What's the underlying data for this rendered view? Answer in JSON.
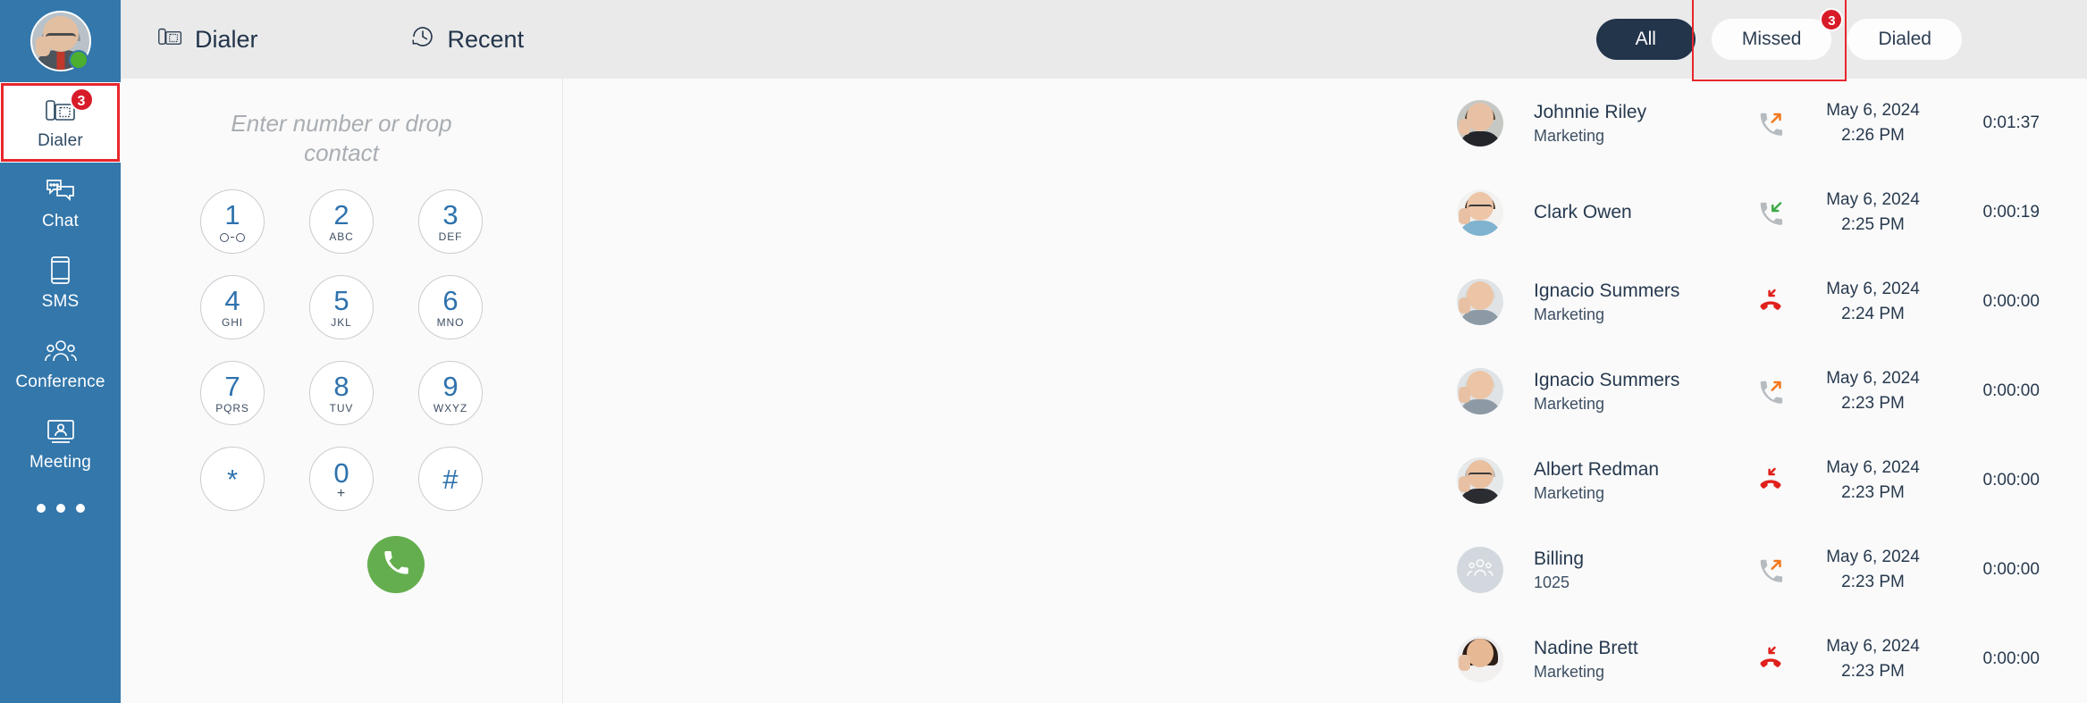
{
  "sidebar": {
    "avatar_name": "user-avatar",
    "presence": "online",
    "items": [
      {
        "id": "dialer",
        "label": "Dialer",
        "icon": "desk-phone-icon",
        "badge": "3",
        "active": true,
        "highlighted": true
      },
      {
        "id": "chat",
        "label": "Chat",
        "icon": "chat-bubbles-icon",
        "badge": "",
        "active": false,
        "highlighted": false
      },
      {
        "id": "sms",
        "label": "SMS",
        "icon": "mobile-phone-icon",
        "badge": "",
        "active": false,
        "highlighted": false
      },
      {
        "id": "conference",
        "label": "Conference",
        "icon": "people-group-icon",
        "badge": "",
        "active": false,
        "highlighted": false
      },
      {
        "id": "meeting",
        "label": "Meeting",
        "icon": "screen-person-icon",
        "badge": "",
        "active": false,
        "highlighted": false
      }
    ],
    "more_label": "more-options"
  },
  "topbar": {
    "dialer_title": "Dialer",
    "dialer_icon": "desk-phone-icon",
    "recent_title": "Recent",
    "recent_icon": "clock-history-icon",
    "filters": [
      {
        "id": "all",
        "label": "All",
        "active": true,
        "badge": "",
        "highlighted": false
      },
      {
        "id": "missed",
        "label": "Missed",
        "active": false,
        "badge": "3",
        "highlighted": true
      },
      {
        "id": "dialed",
        "label": "Dialed",
        "active": false,
        "badge": "",
        "highlighted": false
      }
    ]
  },
  "dialer": {
    "input_value": "",
    "input_placeholder": "Enter number or drop contact",
    "call_button_icon": "phone-handset-icon",
    "keys": [
      {
        "digit": "1",
        "sub": "",
        "icon": "voicemail-icon"
      },
      {
        "digit": "2",
        "sub": "ABC",
        "icon": ""
      },
      {
        "digit": "3",
        "sub": "DEF",
        "icon": ""
      },
      {
        "digit": "4",
        "sub": "GHI",
        "icon": ""
      },
      {
        "digit": "5",
        "sub": "JKL",
        "icon": ""
      },
      {
        "digit": "6",
        "sub": "MNO",
        "icon": ""
      },
      {
        "digit": "7",
        "sub": "PQRS",
        "icon": ""
      },
      {
        "digit": "8",
        "sub": "TUV",
        "icon": ""
      },
      {
        "digit": "9",
        "sub": "WXYZ",
        "icon": ""
      },
      {
        "digit": "*",
        "sub": "",
        "icon": ""
      },
      {
        "digit": "0",
        "sub": "+",
        "icon": ""
      },
      {
        "digit": "#",
        "sub": "",
        "icon": ""
      }
    ]
  },
  "call_list": {
    "rows": [
      {
        "name": "Johnnie Riley",
        "sub": "Marketing",
        "direction": "outgoing",
        "direction_icon": "outgoing-call-icon",
        "date": "May 6, 2024",
        "time": "2:26 PM",
        "duration": "0:01:37",
        "avatar": "photo-young-man-beard"
      },
      {
        "name": "Clark Owen",
        "sub": "",
        "direction": "incoming",
        "direction_icon": "incoming-call-icon",
        "date": "May 6, 2024",
        "time": "2:25 PM",
        "duration": "0:00:19",
        "avatar": "photo-man-glasses"
      },
      {
        "name": "Ignacio Summers",
        "sub": "Marketing",
        "direction": "missed",
        "direction_icon": "missed-call-icon",
        "date": "May 6, 2024",
        "time": "2:24 PM",
        "duration": "0:00:00",
        "avatar": "photo-older-man"
      },
      {
        "name": "Ignacio Summers",
        "sub": "Marketing",
        "direction": "outgoing",
        "direction_icon": "outgoing-call-icon",
        "date": "May 6, 2024",
        "time": "2:23 PM",
        "duration": "0:00:00",
        "avatar": "photo-older-man"
      },
      {
        "name": "Albert Redman",
        "sub": "Marketing",
        "direction": "missed",
        "direction_icon": "missed-call-icon",
        "date": "May 6, 2024",
        "time": "2:23 PM",
        "duration": "0:00:00",
        "avatar": "photo-man-dark-glasses"
      },
      {
        "name": "Billing",
        "sub": "1025",
        "direction": "outgoing",
        "direction_icon": "outgoing-call-icon",
        "date": "May 6, 2024",
        "time": "2:23 PM",
        "duration": "0:00:00",
        "avatar": "group-icon"
      },
      {
        "name": "Nadine Brett",
        "sub": "Marketing",
        "direction": "missed",
        "direction_icon": "missed-call-icon",
        "date": "May 6, 2024",
        "time": "2:23 PM",
        "duration": "0:00:00",
        "avatar": "photo-woman-dark-hair"
      }
    ]
  },
  "colors": {
    "sidebar_blue": "#3377ab",
    "topbar_grey": "#eaeaea",
    "active_pill": "#23354b",
    "badge_red": "#d81b28",
    "highlight_red": "#e8262c",
    "call_green": "#65ae4f",
    "digit_blue": "#2e72ad",
    "outgoing_orange": "#f2781e",
    "incoming_green": "#3faa49",
    "missed_red": "#e0201b",
    "handset_grey": "#b6bbc0"
  }
}
